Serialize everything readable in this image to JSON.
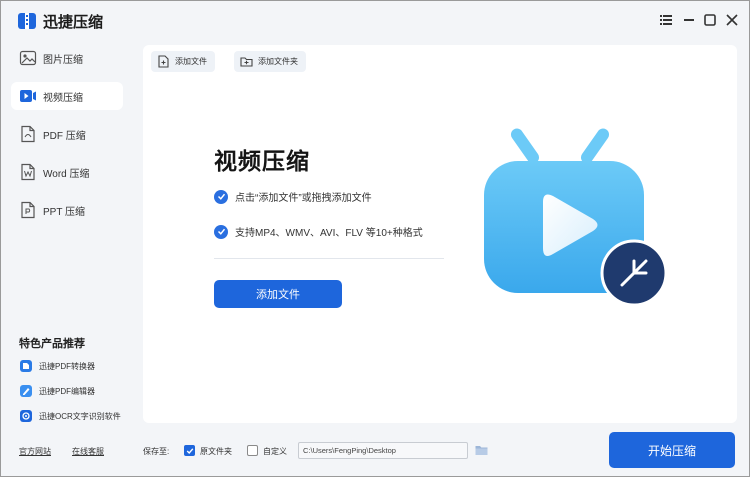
{
  "app": {
    "title": "迅捷压缩",
    "window_controls": [
      "menu-icon",
      "minimize-icon",
      "maximize-icon",
      "close-icon"
    ]
  },
  "sidebar": {
    "items": [
      {
        "label": "图片压缩",
        "icon": "image-icon",
        "active": false
      },
      {
        "label": "视频压缩",
        "icon": "video-icon",
        "active": true
      },
      {
        "label": "PDF 压缩",
        "icon": "pdf-icon",
        "active": false
      },
      {
        "label": "Word 压缩",
        "icon": "word-icon",
        "active": false
      },
      {
        "label": "PPT 压缩",
        "icon": "ppt-icon",
        "active": false
      }
    ],
    "promo_title": "特色产品推荐",
    "promo_items": [
      {
        "label": "迅捷PDF转换器",
        "icon": "pdf-converter-icon"
      },
      {
        "label": "迅捷PDF编辑器",
        "icon": "pdf-editor-icon"
      },
      {
        "label": "迅捷OCR文字识别软件",
        "icon": "ocr-icon"
      }
    ]
  },
  "toolbar": {
    "add_file": "添加文件",
    "add_folder": "添加文件夹"
  },
  "main": {
    "heading": "视频压缩",
    "features": [
      "点击“添加文件”或拖拽添加文件",
      "支持MP4、WMV、AVI、FLV 等10+种格式"
    ],
    "add_button": "添加文件"
  },
  "bottom": {
    "official_site": "官方网站",
    "online_support": "在线客服",
    "save_to_label": "保存至:",
    "option_original": "原文件夹",
    "option_original_checked": true,
    "option_custom": "自定义",
    "option_custom_checked": false,
    "path_value": "C:\\Users\\FengPing\\Desktop",
    "start_button": "开始压缩"
  },
  "colors": {
    "accent": "#1e66dc",
    "background": "#f3f5f8",
    "tv_body": "#4fb8f2",
    "tv_badge": "#223a6b"
  }
}
